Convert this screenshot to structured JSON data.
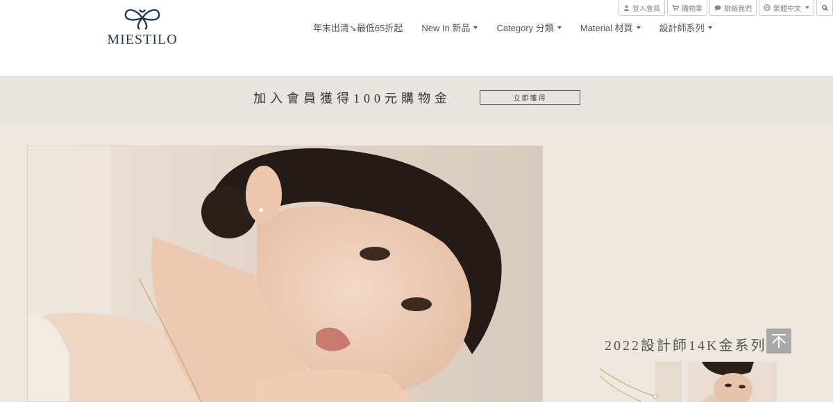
{
  "brand": {
    "name": "MIESTILO"
  },
  "nav": {
    "items": [
      {
        "label": "年末出清↘最低65折起",
        "dropdown": false
      },
      {
        "label": "New In 新品",
        "dropdown": true
      },
      {
        "label": "Category 分類",
        "dropdown": true
      },
      {
        "label": "Material 材質",
        "dropdown": true
      },
      {
        "label": "設計師系列",
        "dropdown": true
      }
    ]
  },
  "topbar": {
    "login": "登入會員",
    "cart": "購物車",
    "contact": "聯絡我們",
    "language": "繁體中文"
  },
  "banner": {
    "text": "加入會員獲得100元購物金",
    "button": "立即獲得"
  },
  "promo": {
    "title": "2022設計師14K金系列"
  },
  "colors": {
    "brand": "#1f3a52",
    "banner_bg": "#e8e5e0",
    "main_bg": "#efe8e1"
  },
  "icons": [
    "user-icon",
    "cart-icon",
    "chat-icon",
    "globe-icon",
    "search-icon",
    "back-to-top-icon"
  ]
}
